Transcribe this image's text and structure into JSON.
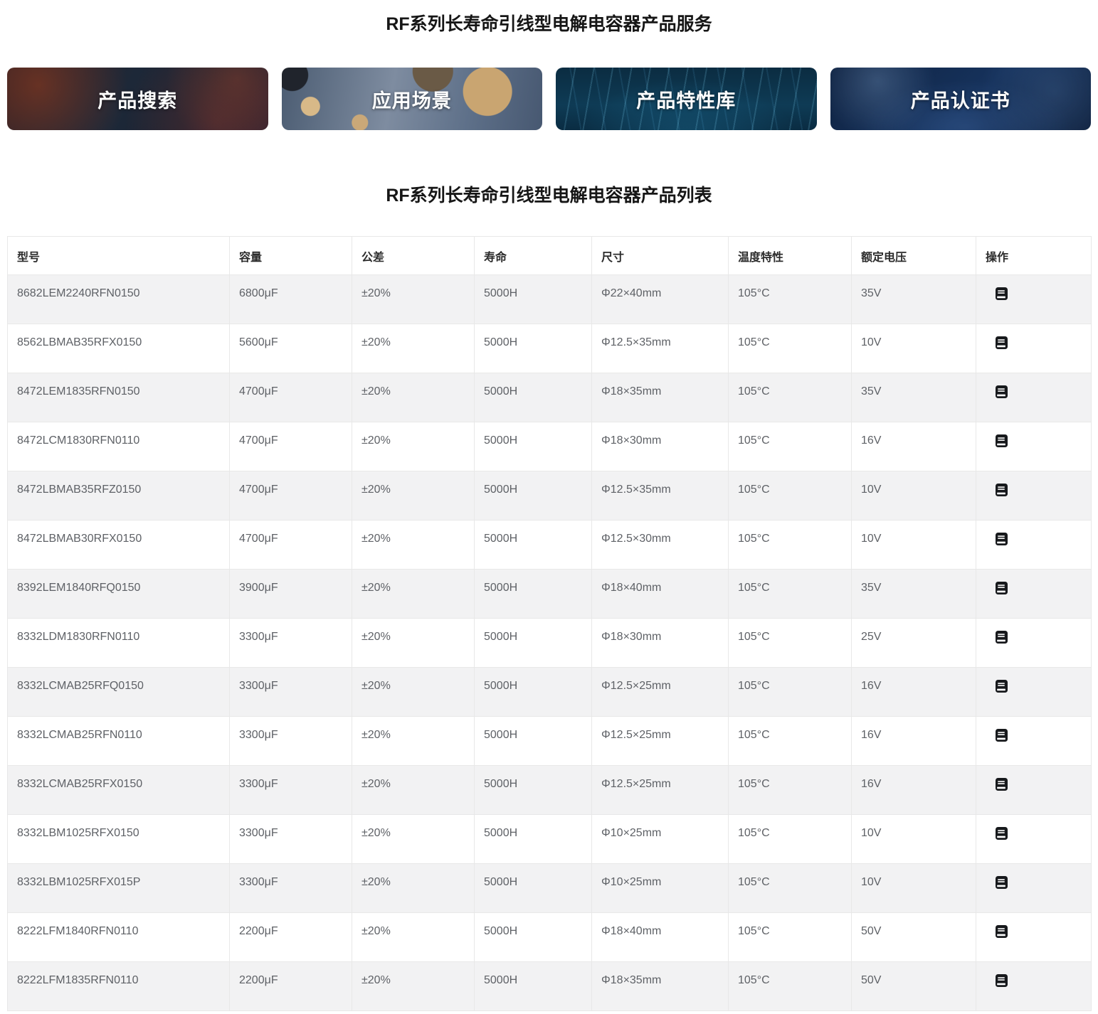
{
  "titles": {
    "service": "RF系列长寿命引线型电解电容器产品服务",
    "list": "RF系列长寿命引线型电解电容器产品列表"
  },
  "nav_cards": [
    {
      "id": "product-search",
      "label": "产品搜索"
    },
    {
      "id": "application-scenarios",
      "label": "应用场景"
    },
    {
      "id": "product-features",
      "label": "产品特性库"
    },
    {
      "id": "product-certificates",
      "label": "产品认证书"
    }
  ],
  "table": {
    "columns": [
      "型号",
      "容量",
      "公差",
      "寿命",
      "尺寸",
      "温度特性",
      "额定电压",
      "操作"
    ],
    "action_icon": "book-icon",
    "rows": [
      [
        "8682LEM2240RFN0150",
        "6800μF",
        "±20%",
        "5000H",
        "Φ22×40mm",
        "105°C",
        "35V"
      ],
      [
        "8562LBMAB35RFX0150",
        "5600μF",
        "±20%",
        "5000H",
        "Φ12.5×35mm",
        "105°C",
        "10V"
      ],
      [
        "8472LEM1835RFN0150",
        "4700μF",
        "±20%",
        "5000H",
        "Φ18×35mm",
        "105°C",
        "35V"
      ],
      [
        "8472LCM1830RFN0110",
        "4700μF",
        "±20%",
        "5000H",
        "Φ18×30mm",
        "105°C",
        "16V"
      ],
      [
        "8472LBMAB35RFZ0150",
        "4700μF",
        "±20%",
        "5000H",
        "Φ12.5×35mm",
        "105°C",
        "10V"
      ],
      [
        "8472LBMAB30RFX0150",
        "4700μF",
        "±20%",
        "5000H",
        "Φ12.5×30mm",
        "105°C",
        "10V"
      ],
      [
        "8392LEM1840RFQ0150",
        "3900μF",
        "±20%",
        "5000H",
        "Φ18×40mm",
        "105°C",
        "35V"
      ],
      [
        "8332LDM1830RFN0110",
        "3300μF",
        "±20%",
        "5000H",
        "Φ18×30mm",
        "105°C",
        "25V"
      ],
      [
        "8332LCMAB25RFQ0150",
        "3300μF",
        "±20%",
        "5000H",
        "Φ12.5×25mm",
        "105°C",
        "16V"
      ],
      [
        "8332LCMAB25RFN0110",
        "3300μF",
        "±20%",
        "5000H",
        "Φ12.5×25mm",
        "105°C",
        "16V"
      ],
      [
        "8332LCMAB25RFX0150",
        "3300μF",
        "±20%",
        "5000H",
        "Φ12.5×25mm",
        "105°C",
        "16V"
      ],
      [
        "8332LBM1025RFX0150",
        "3300μF",
        "±20%",
        "5000H",
        "Φ10×25mm",
        "105°C",
        "10V"
      ],
      [
        "8332LBM1025RFX015P",
        "3300μF",
        "±20%",
        "5000H",
        "Φ10×25mm",
        "105°C",
        "10V"
      ],
      [
        "8222LFM1840RFN0110",
        "2200μF",
        "±20%",
        "5000H",
        "Φ18×40mm",
        "105°C",
        "50V"
      ],
      [
        "8222LFM1835RFN0110",
        "2200μF",
        "±20%",
        "5000H",
        "Φ18×35mm",
        "105°C",
        "50V"
      ]
    ]
  },
  "colors": {
    "stripe_row": "#f2f2f3",
    "table_border": "#e8e8e8",
    "cell_text": "#5e6166",
    "header_text": "#2b2b2b",
    "icon": "#17191c"
  }
}
